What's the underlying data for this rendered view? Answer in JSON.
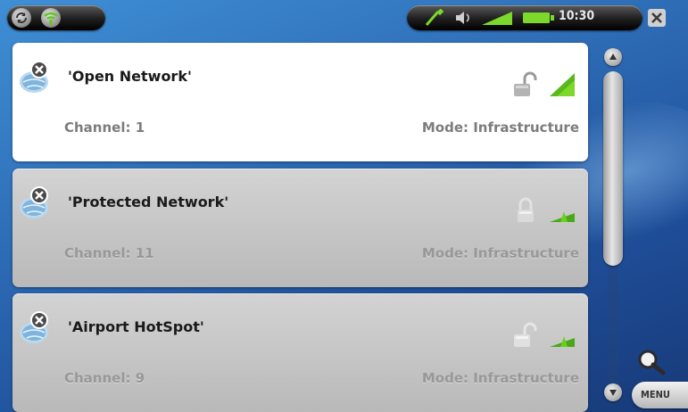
{
  "status_bar": {
    "left_icons": [
      "sync-icon",
      "wifi-icon"
    ],
    "right_icons": [
      "usb-plug-icon",
      "speaker-icon",
      "volume-level-icon",
      "battery-icon"
    ],
    "clock": "10:30",
    "close_icon": "close-icon",
    "colors": {
      "accent_green": "#7cd82a",
      "pill": "#1d1d1d"
    }
  },
  "networks": [
    {
      "name": "'Open Network'",
      "channel": "Channel: 1",
      "mode": "Mode: Infrastructure",
      "lock_icon": "open-lock-icon",
      "signal_icon": "signal-strength-icon",
      "selected": true
    },
    {
      "name": "'Protected Network'",
      "channel": "Channel: 11",
      "mode": "Mode: Infrastructure",
      "lock_icon": "closed-lock-icon",
      "signal_icon": "signal-strength-icon",
      "selected": false
    },
    {
      "name": "'Airport HotSpot'",
      "channel": "Channel: 9",
      "mode": "Mode: Infrastructure",
      "lock_icon": "open-lock-icon",
      "signal_icon": "signal-strength-icon",
      "selected": false
    }
  ],
  "scrollbar": {
    "up_icon": "scroll-up-icon",
    "down_icon": "scroll-down-icon"
  },
  "buttons": {
    "zoom_icon": "magnifier-icon",
    "menu_label": "MENU"
  }
}
